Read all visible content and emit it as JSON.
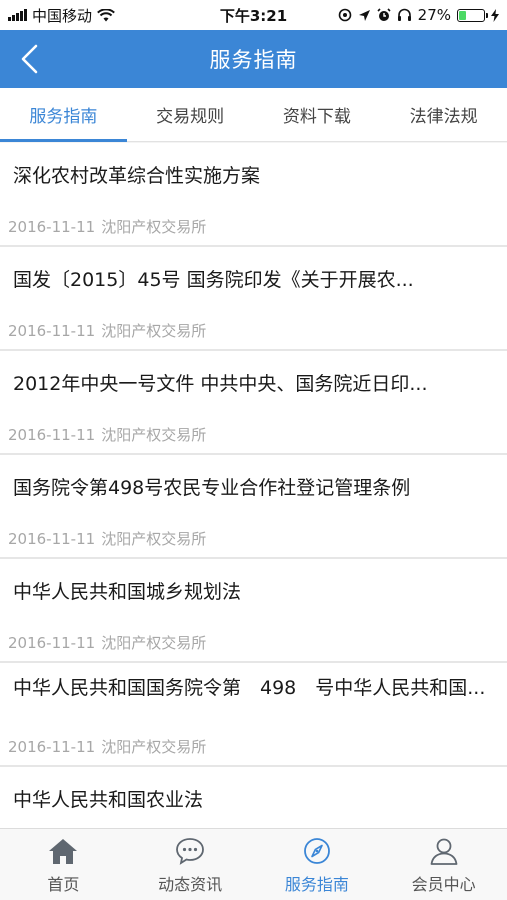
{
  "status_bar": {
    "carrier": "中国移动",
    "time": "下午3:21",
    "battery": "27%",
    "battery_level": 0.27
  },
  "navbar": {
    "title": "服务指南",
    "back_icon": "chevron-left-icon"
  },
  "tabs": [
    {
      "label": "服务指南",
      "active": true
    },
    {
      "label": "交易规则",
      "active": false
    },
    {
      "label": "资料下载",
      "active": false
    },
    {
      "label": "法律法规",
      "active": false
    }
  ],
  "items": [
    {
      "title": "深化农村改革综合性实施方案",
      "date": "2016-11-11",
      "source": "沈阳产权交易所"
    },
    {
      "title": "国发〔2015〕45号 国务院印发《关于开展农...",
      "date": "2016-11-11",
      "source": "沈阳产权交易所"
    },
    {
      "title": "2012年中央一号文件 中共中央、国务院近日印...",
      "date": "2016-11-11",
      "source": "沈阳产权交易所"
    },
    {
      "title": "国务院令第498号农民专业合作社登记管理条例",
      "date": "2016-11-11",
      "source": "沈阳产权交易所"
    },
    {
      "title": "中华人民共和国城乡规划法",
      "date": "2016-11-11",
      "source": "沈阳产权交易所"
    },
    {
      "title": "中华人民共和国国务院令第　498　号中华人民共和国...",
      "date": "2016-11-11",
      "source": "沈阳产权交易所"
    },
    {
      "title": "中华人民共和国农业法",
      "date": "",
      "source": ""
    }
  ],
  "tabbar": [
    {
      "label": "首页",
      "icon": "home-icon",
      "active": false
    },
    {
      "label": "动态资讯",
      "icon": "chat-bubble-icon",
      "active": false
    },
    {
      "label": "服务指南",
      "icon": "compass-icon",
      "active": true
    },
    {
      "label": "会员中心",
      "icon": "user-icon",
      "active": false
    }
  ],
  "colors": {
    "accent": "#3b86d6",
    "battery_green": "#4cd964"
  }
}
